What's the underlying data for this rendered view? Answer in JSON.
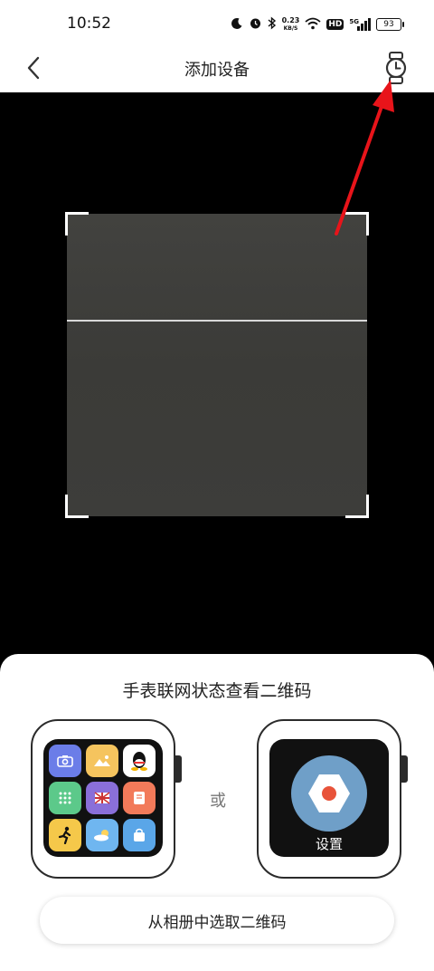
{
  "status_bar": {
    "time": "10:52",
    "net_speed_value": "0.23",
    "net_speed_unit": "KB/S",
    "hd_label": "HD",
    "network_label": "5G",
    "battery_level": "93",
    "icons": [
      "moon-icon",
      "alarm-icon",
      "bluetooth-icon",
      "wifi-icon",
      "signal-icon",
      "battery-icon"
    ]
  },
  "header": {
    "title": "添加设备",
    "back_icon": "chevron-left-icon",
    "right_icon": "watch-icon"
  },
  "scanner": {
    "frame_color": "#ffffff",
    "scan_line_color": "#d8d8d8"
  },
  "annotation": {
    "arrow_color": "#e8141a"
  },
  "sheet": {
    "title": "手表联网状态查看二维码",
    "separator": "或",
    "settings_label": "设置",
    "album_button": "从相册中选取二维码",
    "watch_apps": [
      {
        "icon": "camera-icon",
        "color": "#6b7de8"
      },
      {
        "icon": "photo-icon",
        "color": "#f5c45e"
      },
      {
        "icon": "qq-icon",
        "color": "#ffffff"
      },
      {
        "icon": "dialpad-icon",
        "color": "#5cc98a"
      },
      {
        "icon": "flag-icon",
        "color": "#8a6fd9"
      },
      {
        "icon": "note-icon",
        "color": "#f27a5a"
      },
      {
        "icon": "running-icon",
        "color": "#f5c84a"
      },
      {
        "icon": "weather-icon",
        "color": "#6fb6f0"
      },
      {
        "icon": "bag-icon",
        "color": "#5aa6e8"
      }
    ]
  }
}
